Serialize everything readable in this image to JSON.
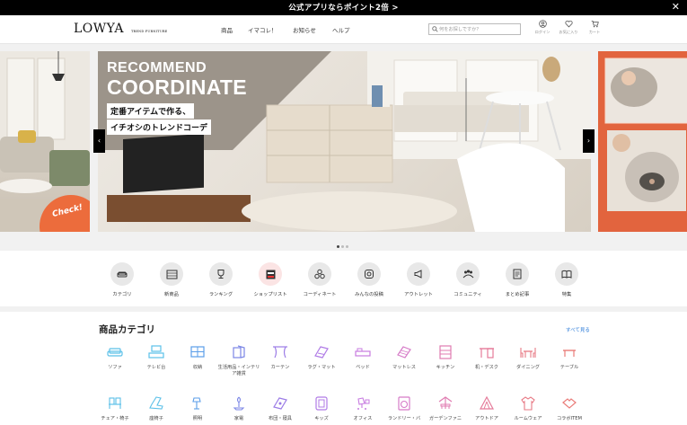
{
  "promo_bar": {
    "text": "公式アプリならポイント2倍 >",
    "close": "✕"
  },
  "header": {
    "logo": "LOWYA",
    "logo_sub": "TREND FURNITURE",
    "nav": [
      "商品",
      "イマコレ！",
      "お知らせ",
      "ヘルプ"
    ],
    "search_placeholder": "何をお探しですか？",
    "icons": [
      {
        "name": "user-icon",
        "label": "ログイン"
      },
      {
        "name": "heart-icon",
        "label": "お気に入り"
      },
      {
        "name": "cart-icon",
        "label": "カート"
      }
    ]
  },
  "hero": {
    "headline1": "RECOMMEND",
    "headline2": "COORDINATE",
    "tagline1": "定番アイテムで作る、",
    "tagline2": "イチオシのトレンドコーデ",
    "left_badge": "Check!",
    "prev": "‹",
    "next": "›",
    "active_dot": 1,
    "dot_count": 3
  },
  "quick_nav": [
    {
      "icon": "sofa-icon",
      "label": "カテゴリ"
    },
    {
      "icon": "new-icon",
      "label": "新商品"
    },
    {
      "icon": "trophy-icon",
      "label": "ランキング"
    },
    {
      "icon": "shop-icon",
      "label": "ショップリスト"
    },
    {
      "icon": "coordinate-icon",
      "label": "コーディネート"
    },
    {
      "icon": "instagram-icon",
      "label": "みんなの投稿"
    },
    {
      "icon": "megaphone-icon",
      "label": "アウトレット"
    },
    {
      "icon": "community-icon",
      "label": "コミュニティ"
    },
    {
      "icon": "article-icon",
      "label": "まとめ記事"
    },
    {
      "icon": "book-icon",
      "label": "特集"
    }
  ],
  "categories": {
    "title": "商品カテゴリ",
    "see_all": "すべて見る",
    "row1": [
      {
        "icon": "sofa-icon",
        "label": "ソファ",
        "color": "#5bc0e8"
      },
      {
        "icon": "tv-stand-icon",
        "label": "テレビ台",
        "color": "#5bc0e8"
      },
      {
        "icon": "storage-icon",
        "label": "収納",
        "color": "#5b9ee8"
      },
      {
        "icon": "goods-icon",
        "label": "生活用品・インテリア雑貨",
        "color": "#7b86e6"
      },
      {
        "icon": "curtain-icon",
        "label": "カーテン",
        "color": "#9b7be6"
      },
      {
        "icon": "rug-icon",
        "label": "ラグ・マット",
        "color": "#b07be6"
      },
      {
        "icon": "bed-icon",
        "label": "ベッド",
        "color": "#c77be0"
      },
      {
        "icon": "mattress-icon",
        "label": "マットレス",
        "color": "#d67bc8"
      },
      {
        "icon": "kitchen-icon",
        "label": "キッチン",
        "color": "#e07bb0"
      },
      {
        "icon": "desk-icon",
        "label": "机・デスク",
        "color": "#e57b9a"
      },
      {
        "icon": "dining-icon",
        "label": "ダイニング",
        "color": "#e87b86"
      },
      {
        "icon": "table-icon",
        "label": "テーブル",
        "color": "#ea7b78"
      }
    ],
    "row2": [
      {
        "icon": "chair-icon",
        "label": "チェア・椅子",
        "color": "#5bc0e8"
      },
      {
        "icon": "floor-chair-icon",
        "label": "座椅子",
        "color": "#5bc0e8"
      },
      {
        "icon": "lamp-icon",
        "label": "照明",
        "color": "#5b9ee8"
      },
      {
        "icon": "appliance-icon",
        "label": "家電",
        "color": "#7b86e6"
      },
      {
        "icon": "futon-icon",
        "label": "布団・寝具",
        "color": "#9b7be6"
      },
      {
        "icon": "kids-icon",
        "label": "キッズ",
        "color": "#b07be6"
      },
      {
        "icon": "office-icon",
        "label": "オフィス",
        "color": "#c77be0"
      },
      {
        "icon": "laundry-icon",
        "label": "ランドリー・バ",
        "color": "#d67bc8"
      },
      {
        "icon": "garden-icon",
        "label": "ガーデンファニ",
        "color": "#e07bb0"
      },
      {
        "icon": "tent-icon",
        "label": "アウトドア",
        "color": "#e57b9a"
      },
      {
        "icon": "roomwear-icon",
        "label": "ルームウェア",
        "color": "#e87b86"
      },
      {
        "icon": "collab-icon",
        "label": "コラボITEM",
        "color": "#ea7b78"
      }
    ]
  }
}
